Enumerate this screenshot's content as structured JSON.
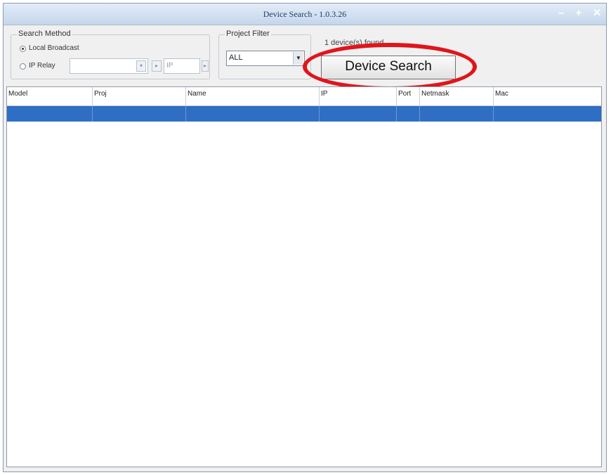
{
  "window": {
    "title": "Device Search - 1.0.3.26",
    "controls": {
      "minimize": "–",
      "maximize": "+",
      "close": "✕"
    }
  },
  "search_method": {
    "legend": "Search Method",
    "options": [
      {
        "label": "Local Broadcast",
        "checked": true
      },
      {
        "label": "IP Relay",
        "checked": false
      }
    ],
    "relay_ip_value": "",
    "relay_port_placeholder": "IP",
    "icons": [
      "ip-dropdown-icon",
      "ip-options-icon"
    ]
  },
  "project_filter": {
    "legend": "Project Filter",
    "selected": "ALL",
    "icon": "chevron-down-icon"
  },
  "status_text": "1 device(s) found",
  "search_button_label": "Device Search",
  "highlight_color": "#e0151b",
  "table": {
    "columns": [
      "Model",
      "Proj",
      "Name",
      "IP",
      "Port",
      "Netmask",
      "Mac"
    ],
    "rows": [
      [
        "",
        "",
        "",
        "",
        "",
        "",
        ""
      ]
    ],
    "selected_row_color": "#2e6fc4"
  }
}
